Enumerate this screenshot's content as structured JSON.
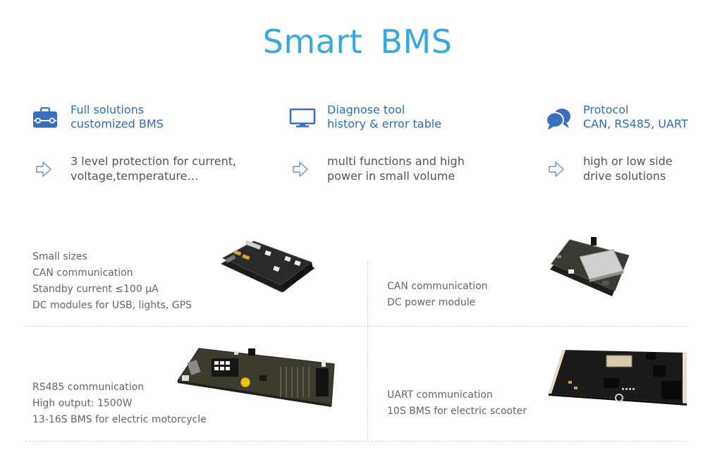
{
  "page": {
    "title": "Smart  BMS",
    "accent_color": "#3ba7e0",
    "heading_color": "#2f6cb5"
  },
  "features": [
    {
      "icon": "briefcase-icon",
      "heading_line1": "Full solutions",
      "heading_line2": "customized BMS",
      "desc_icon": "arrow-right-outline-icon",
      "desc_line1": "3 level protection for current,",
      "desc_line2": "voltage,temperature…"
    },
    {
      "icon": "monitor-icon",
      "heading_line1": "Diagnose tool",
      "heading_line2": "history & error table",
      "desc_icon": "arrow-right-outline-icon",
      "desc_line1": "multi functions and high",
      "desc_line2": "power in small volume"
    },
    {
      "icon": "chat-bubbles-icon",
      "heading_line1": "Protocol",
      "heading_line2": "CAN, RS485, UART",
      "desc_icon": "arrow-right-outline-icon",
      "desc_line1": "high or low side",
      "desc_line2": "drive solutions"
    }
  ],
  "products": [
    {
      "image": "bms-board-stacked-image",
      "lines": [
        "Small sizes",
        "CAN communication",
        "Standby current  ≤100 μA",
        "DC modules for USB, lights, GPS"
      ]
    },
    {
      "image": "bms-board-shielded-image",
      "lines": [
        "CAN communication",
        "DC power module"
      ]
    },
    {
      "image": "bms-board-long-image",
      "lines": [
        "RS485 communication",
        "High output: 1500W",
        "13-16S BMS for electric motorcycle"
      ]
    },
    {
      "image": "bms-board-compact-image",
      "lines": [
        "UART communication",
        "10S BMS for electric scooter"
      ]
    }
  ]
}
